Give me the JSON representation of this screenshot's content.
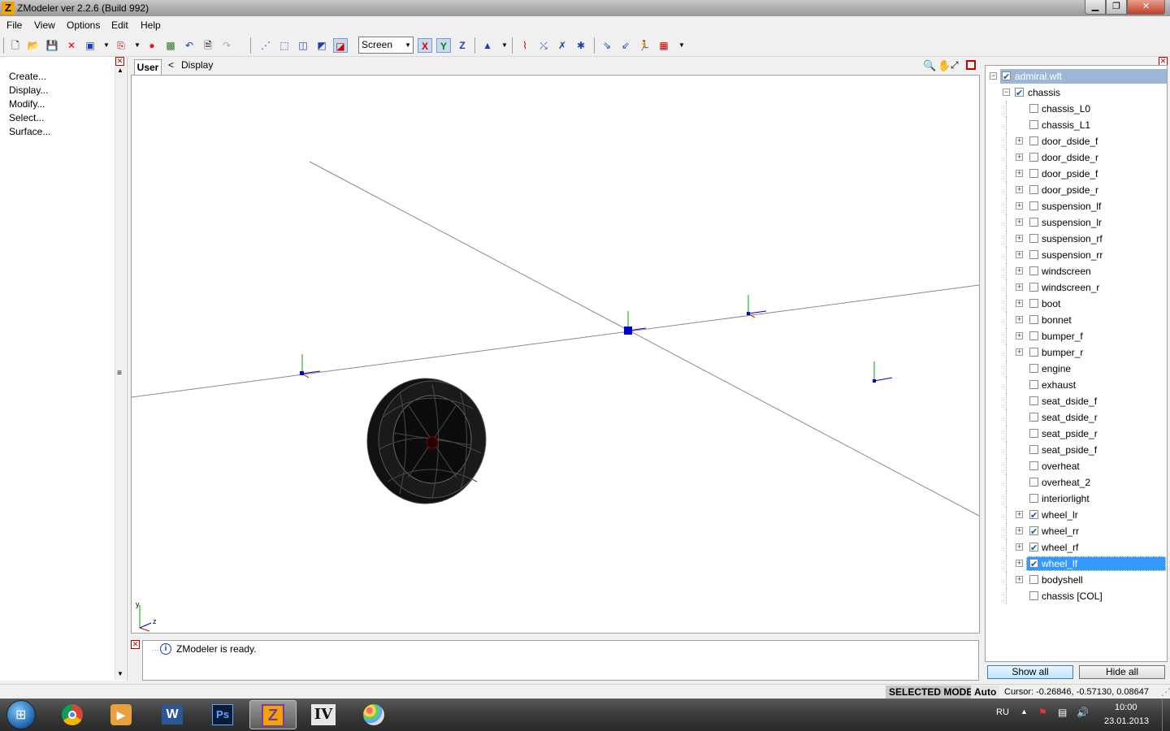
{
  "window": {
    "title": "ZModeler ver 2.2.6 (Build 992)",
    "app_icon": "Z"
  },
  "menu": [
    "File",
    "View",
    "Options",
    "Edit",
    "Help"
  ],
  "toolbar": {
    "coord_system": "Screen",
    "axis_x": "X",
    "axis_y": "Y",
    "axis_z": "Z"
  },
  "left_panel": {
    "commands": [
      "Create...",
      "Display...",
      "Modify...",
      "Select...",
      "Surface..."
    ]
  },
  "viewport": {
    "tab_label": "User",
    "breadcrumb_arrow": "<",
    "breadcrumb": "Display",
    "axis_labels": {
      "y": "y",
      "z": "z"
    }
  },
  "log": {
    "message": "ZModeler is ready."
  },
  "tree": {
    "root": {
      "label": "admiral.wft",
      "checked": true
    },
    "group": {
      "label": "chassis",
      "checked": true
    },
    "items": [
      {
        "label": "chassis_L0",
        "expandable": false,
        "checked": false
      },
      {
        "label": "chassis_L1",
        "expandable": false,
        "checked": false
      },
      {
        "label": "door_dside_f",
        "expandable": true,
        "checked": false
      },
      {
        "label": "door_dside_r",
        "expandable": true,
        "checked": false
      },
      {
        "label": "door_pside_f",
        "expandable": true,
        "checked": false
      },
      {
        "label": "door_pside_r",
        "expandable": true,
        "checked": false
      },
      {
        "label": "suspension_lf",
        "expandable": true,
        "checked": false
      },
      {
        "label": "suspension_lr",
        "expandable": true,
        "checked": false
      },
      {
        "label": "suspension_rf",
        "expandable": true,
        "checked": false
      },
      {
        "label": "suspension_rr",
        "expandable": true,
        "checked": false
      },
      {
        "label": "windscreen",
        "expandable": true,
        "checked": false
      },
      {
        "label": "windscreen_r",
        "expandable": true,
        "checked": false
      },
      {
        "label": "boot",
        "expandable": true,
        "checked": false
      },
      {
        "label": "bonnet",
        "expandable": true,
        "checked": false
      },
      {
        "label": "bumper_f",
        "expandable": true,
        "checked": false
      },
      {
        "label": "bumper_r",
        "expandable": true,
        "checked": false
      },
      {
        "label": "engine",
        "expandable": false,
        "checked": false
      },
      {
        "label": "exhaust",
        "expandable": false,
        "checked": false
      },
      {
        "label": "seat_dside_f",
        "expandable": false,
        "checked": false
      },
      {
        "label": "seat_dside_r",
        "expandable": false,
        "checked": false
      },
      {
        "label": "seat_pside_r",
        "expandable": false,
        "checked": false
      },
      {
        "label": "seat_pside_f",
        "expandable": false,
        "checked": false
      },
      {
        "label": "overheat",
        "expandable": false,
        "checked": false
      },
      {
        "label": "overheat_2",
        "expandable": false,
        "checked": false
      },
      {
        "label": "interiorlight",
        "expandable": false,
        "checked": false
      },
      {
        "label": "wheel_lr",
        "expandable": true,
        "checked": true
      },
      {
        "label": "wheel_rr",
        "expandable": true,
        "checked": true
      },
      {
        "label": "wheel_rf",
        "expandable": true,
        "checked": true
      },
      {
        "label": "wheel_lf",
        "expandable": true,
        "checked": true,
        "selected": true
      },
      {
        "label": "bodyshell",
        "expandable": true,
        "checked": false
      },
      {
        "label": "chassis [COL]",
        "expandable": false,
        "checked": false
      }
    ],
    "show_all": "Show all",
    "hide_all": "Hide all"
  },
  "status": {
    "mode": "SELECTED MODE",
    "auto": "Auto",
    "cursor": "Cursor: -0.26846, -0.57130, 0.08647"
  },
  "taskbar": {
    "apps": [
      "start-orb",
      "chrome",
      "media-player",
      "word",
      "photoshop",
      "zmodeler",
      "gta-iv",
      "paint"
    ],
    "active_app": "zmodeler",
    "zmodeler_glyph": "Z",
    "word_glyph": "W",
    "photoshop_glyph": "Ps",
    "gtaiv_glyph": "IV",
    "lang": "RU",
    "time": "10:00",
    "date": "23.01.2013"
  },
  "colors": {
    "selection": "#3399ff",
    "accent_red": "#c00000",
    "axis_blue": "#0000cc",
    "axis_green": "#008800"
  }
}
